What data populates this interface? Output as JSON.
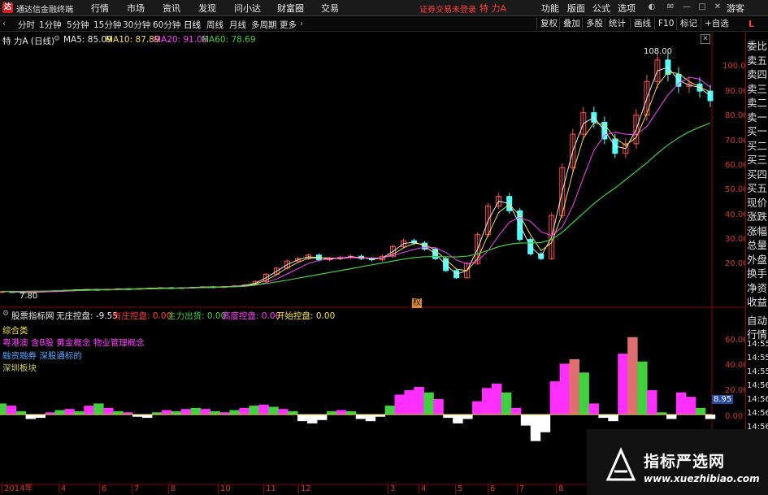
{
  "app": {
    "title": "通达信金融终端",
    "menu": [
      "行情",
      "市场",
      "资讯",
      "发现",
      "问小达",
      "财富圈",
      "交易"
    ],
    "trade_status": "证券交易未登录",
    "stock_name": "特 力A",
    "right_menu": [
      "功能",
      "版面",
      "公式",
      "选项"
    ],
    "guest": "游客"
  },
  "toolbar": {
    "periods": [
      "分时",
      "1分钟",
      "5分钟",
      "15分钟",
      "30分钟",
      "60分钟",
      "日线",
      "周线",
      "月线",
      "多周期",
      "更多"
    ],
    "active_period": "日线",
    "right_buttons": [
      "复权",
      "叠加",
      "多股",
      "统计",
      "画线",
      "F10",
      "标记",
      "+自选"
    ],
    "right_marker": "L"
  },
  "main_chart": {
    "title": "特 力A (日线)",
    "ma": [
      {
        "label": "MA5: 85.09",
        "color": "#e8e8e8"
      },
      {
        "label": "MA10: 87.89",
        "color": "#f0e040"
      },
      {
        "label": "MA20: 91.08",
        "color": "#ff40ff"
      },
      {
        "label": "MA60: 78.69",
        "color": "#40d040"
      }
    ],
    "high_label": "108.00",
    "low_label": "7.80",
    "y_ticks": [
      "100.00",
      "90.00",
      "80.00",
      "70.00",
      "60.00",
      "50.00",
      "40.00",
      "30.00",
      "20.00"
    ],
    "event_marker": "权"
  },
  "indicator": {
    "title": "股票指标网",
    "values": [
      {
        "label": "无庄控盘: -9.55",
        "color": "#e8e8e8"
      },
      {
        "label": "有庄控盘: 0.00",
        "color": "#ff3b3b"
      },
      {
        "label": "主力出货: 0.00",
        "color": "#40d040"
      },
      {
        "label": "高度控盘: 0.00",
        "color": "#ff40ff"
      },
      {
        "label": "开始控盘: 0.00",
        "color": "#f0e040"
      }
    ],
    "concepts": [
      {
        "text": "综合类",
        "color": "#f0e040"
      },
      {
        "text": "粤港澳 含B股 黄金概念 物业管理概念",
        "color": "#ff40ff"
      },
      {
        "text": "融资融券 深股通标的",
        "color": "#4da6ff"
      },
      {
        "text": "深圳板块",
        "color": "#d0d060"
      }
    ],
    "y_ticks": [
      "60.00",
      "40.00",
      "20.00",
      "0.00"
    ],
    "current_value": "8.95"
  },
  "x_axis": [
    "2014年",
    "4",
    "6",
    "7",
    "8",
    "10",
    "11",
    "12",
    "3",
    "4",
    "5",
    "6",
    "7",
    "8"
  ],
  "right_panel": [
    "委比",
    "卖五",
    "卖四",
    "卖三",
    "卖二",
    "卖一",
    "买一",
    "买二",
    "买三",
    "买四",
    "买五",
    "现价",
    "涨跌",
    "涨幅",
    "总量",
    "外盘",
    "换手",
    "净资",
    "收益"
  ],
  "right_panel_bottom": [
    "自动",
    "行情",
    "14:55",
    "14:55",
    "14:55",
    "14:56",
    "14:56",
    "14:56",
    "14:56",
    "14:56",
    "14:56"
  ],
  "watermark": {
    "line1": "指标严选网",
    "line2": "www.xuezhibiao.com"
  },
  "chart_data": {
    "type": "line",
    "price_ylim": [
      7.8,
      108
    ],
    "price_close": [
      8.2,
      8.0,
      7.8,
      8.1,
      8.4,
      8.6,
      8.8,
      9.0,
      9.1,
      9.0,
      9.2,
      9.4,
      9.3,
      9.5,
      9.7,
      9.8,
      9.6,
      9.8,
      10.0,
      10.2,
      10.1,
      10.3,
      10.6,
      11.0,
      12.5,
      15.5,
      18.0,
      21.0,
      22.0,
      23.5,
      21.5,
      22.0,
      22.5,
      23.0,
      22.0,
      21.5,
      23.0,
      27.0,
      29.5,
      28.5,
      26.0,
      22.0,
      17.0,
      14.0,
      20.0,
      32.0,
      44.0,
      48.0,
      42.0,
      30.0,
      24.0,
      22.0,
      40.0,
      60.0,
      74.0,
      83.0,
      79.0,
      72.0,
      66.0,
      70.0,
      82.0,
      96.0,
      105.0,
      99.0,
      94.0,
      95.0,
      92.0,
      88.0
    ],
    "ma60": [
      8.3,
      8.3,
      8.3,
      8.4,
      8.4,
      8.5,
      8.6,
      8.7,
      8.8,
      8.9,
      9.0,
      9.1,
      9.2,
      9.3,
      9.4,
      9.5,
      9.6,
      9.7,
      9.8,
      9.9,
      10.0,
      10.1,
      10.3,
      10.5,
      11.0,
      11.6,
      12.3,
      13.0,
      13.8,
      14.6,
      15.4,
      16.2,
      17.0,
      17.8,
      18.6,
      19.4,
      20.2,
      21.0,
      21.8,
      22.4,
      22.8,
      22.9,
      22.8,
      22.7,
      23.0,
      24.0,
      25.5,
      27.0,
      28.0,
      28.5,
      28.6,
      28.7,
      30.0,
      33.0,
      37.0,
      41.0,
      45.0,
      48.5,
      51.5,
      55.0,
      58.5,
      62.0,
      66.0,
      69.5,
      72.5,
      75.0,
      77.0,
      78.7
    ],
    "indicator_ylim": [
      -25,
      75
    ],
    "indicator_values": [
      10,
      8,
      3,
      -4,
      -3,
      2,
      4,
      5,
      3,
      8,
      10,
      6,
      3,
      2,
      -2,
      -3,
      2,
      4,
      3,
      5,
      6,
      5,
      3,
      2,
      4,
      6,
      8,
      9,
      7,
      5,
      3,
      -6,
      -8,
      -5,
      3,
      4,
      3,
      -4,
      -6,
      -2,
      8,
      18,
      22,
      25,
      20,
      14,
      -3,
      -8,
      -4,
      12,
      24,
      28,
      20,
      6,
      -10,
      -24,
      -16,
      30,
      46,
      50,
      38,
      10,
      -3,
      -6,
      55,
      70,
      48,
      22,
      2,
      -4,
      20,
      16,
      6,
      -4
    ]
  }
}
